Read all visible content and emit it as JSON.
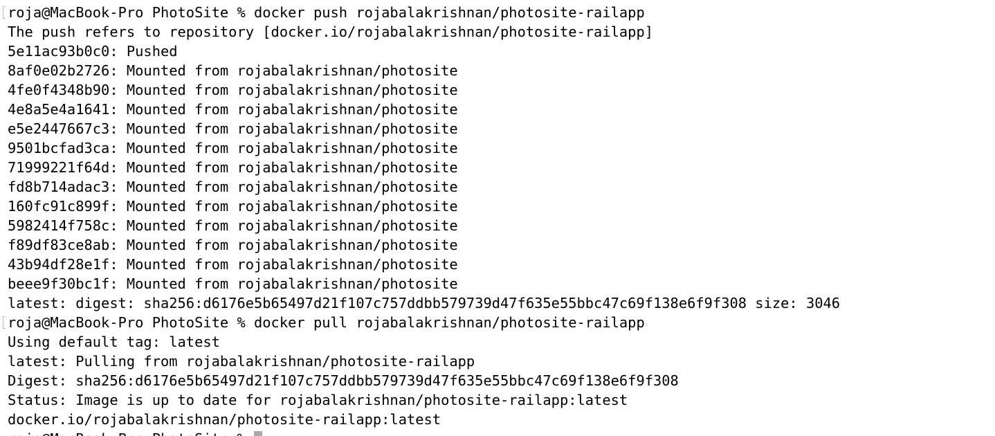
{
  "terminal": {
    "lines": [
      "roja@MacBook-Pro PhotoSite % docker push rojabalakrishnan/photosite-railapp",
      "The push refers to repository [docker.io/rojabalakrishnan/photosite-railapp]",
      "5e11ac93b0c0: Pushed",
      "8af0e02b2726: Mounted from rojabalakrishnan/photosite",
      "4fe0f4348b90: Mounted from rojabalakrishnan/photosite",
      "4e8a5e4a1641: Mounted from rojabalakrishnan/photosite",
      "e5e2447667c3: Mounted from rojabalakrishnan/photosite",
      "9501bcfad3ca: Mounted from rojabalakrishnan/photosite",
      "71999221f64d: Mounted from rojabalakrishnan/photosite",
      "fd8b714adac3: Mounted from rojabalakrishnan/photosite",
      "160fc91c899f: Mounted from rojabalakrishnan/photosite",
      "5982414f758c: Mounted from rojabalakrishnan/photosite",
      "f89df83ce8ab: Mounted from rojabalakrishnan/photosite",
      "43b94df28e1f: Mounted from rojabalakrishnan/photosite",
      "beee9f30bc1f: Mounted from rojabalakrishnan/photosite",
      "latest: digest: sha256:d6176e5b65497d21f107c757ddbb579739d47f635e55bbc47c69f138e6f9f308 size: 3046",
      "roja@MacBook-Pro PhotoSite % docker pull rojabalakrishnan/photosite-railapp",
      "Using default tag: latest",
      "latest: Pulling from rojabalakrishnan/photosite-railapp",
      "Digest: sha256:d6176e5b65497d21f107c757ddbb579739d47f635e55bbc47c69f138e6f9f308",
      "Status: Image is up to date for rojabalakrishnan/photosite-railapp:latest",
      "docker.io/rojabalakrishnan/photosite-railapp:latest"
    ],
    "current_prompt": "roja@MacBook-Pro PhotoSite % "
  }
}
